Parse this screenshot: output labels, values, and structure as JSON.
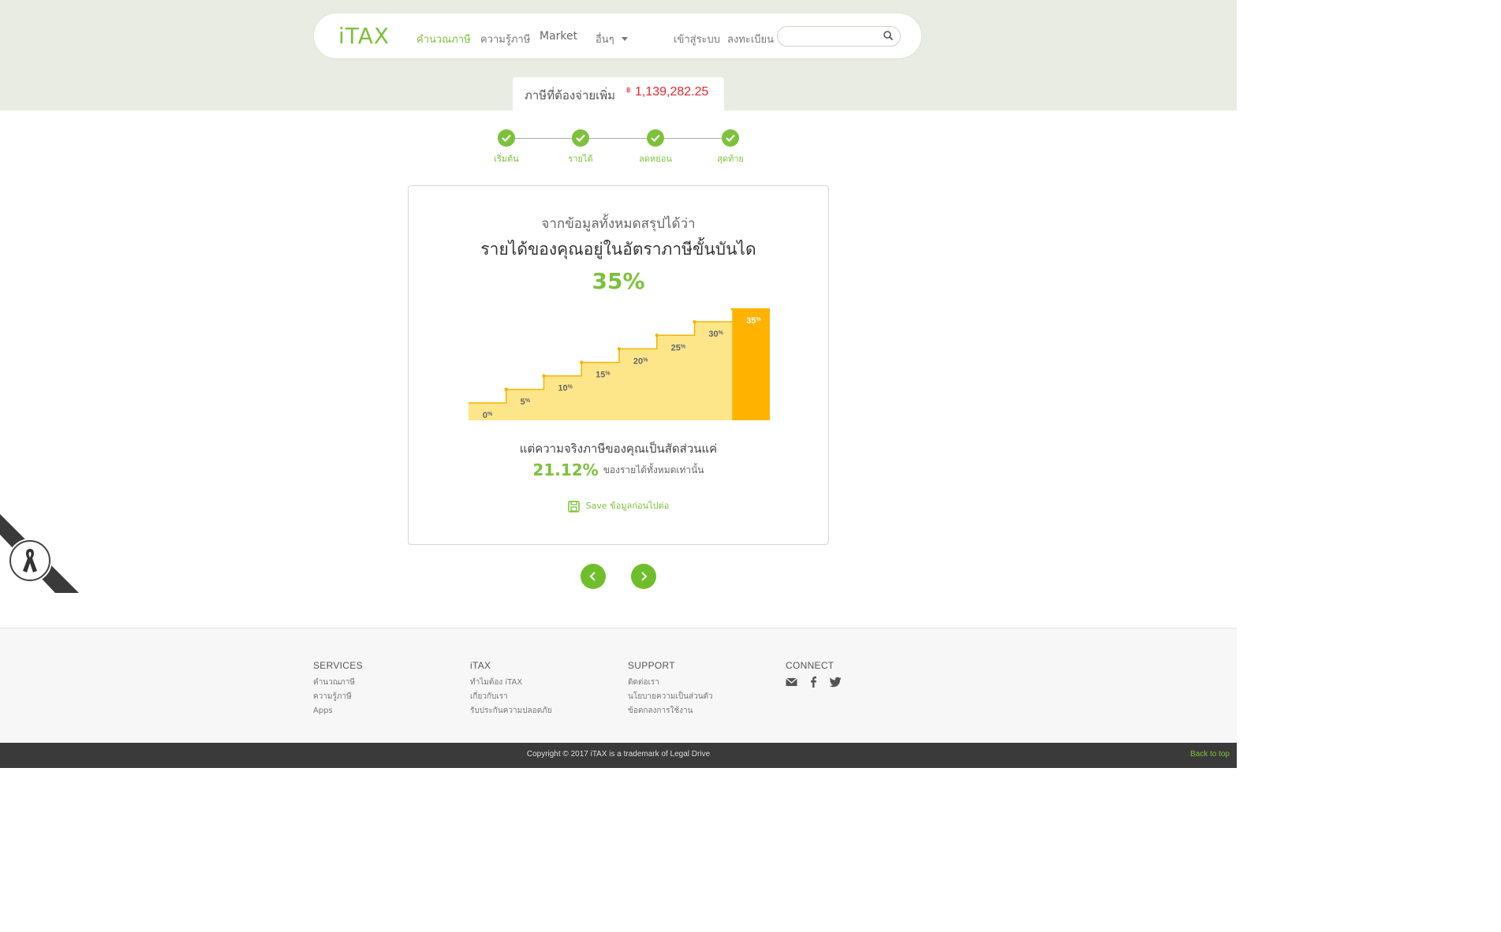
{
  "brand": {
    "logo": "iTAX",
    "accent": "#7cc13a",
    "alert": "#e8262e"
  },
  "nav": {
    "items": [
      "คำนวณภาษี",
      "ความรู้ภาษี",
      "Market",
      "อื่นๆ"
    ],
    "login": "เข้าสู่ระบบ",
    "register": "ลงทะเบียน",
    "search_placeholder": ""
  },
  "tax_due": {
    "label": "ภาษีที่ต้องจ่ายเพิ่ม",
    "currency": "฿",
    "amount": "1,139,282.25"
  },
  "steps": [
    "เริ่มต้น",
    "รายได้",
    "ลดหย่อน",
    "สุดท้าย"
  ],
  "summary": {
    "intro": "จากข้อมูลทั้งหมดสรุปได้ว่า",
    "headline": "รายได้ของคุณอยู่ในอัตราภาษีขั้นบันได",
    "bracket": "35%",
    "reality": "แต่ความจริงภาษีของคุณเป็นสัดส่วนแค่",
    "effective_rate": "21.12%",
    "effective_suffix": "ของรายได้ทั้งหมดเท่านั้น",
    "save_prefix": "Save",
    "save_text": "ข้อมูลก่อนไปต่อ"
  },
  "chart_data": {
    "type": "bar",
    "categories": [
      "0%",
      "5%",
      "10%",
      "15%",
      "20%",
      "25%",
      "30%",
      "35%"
    ],
    "values": [
      0,
      5,
      10,
      15,
      20,
      25,
      30,
      35
    ],
    "highlight_index": 7,
    "colors": {
      "base": "#fde68a",
      "line": "#f5b400",
      "highlight": "#ffb300"
    }
  },
  "footer": {
    "services": {
      "title": "SERVICES",
      "links": [
        "คำนวณภาษี",
        "ความรู้ภาษี",
        "Apps"
      ]
    },
    "itax": {
      "title": "iTAX",
      "links": [
        "ทำไมต้อง iTAX",
        "เกี่ยวกับเรา",
        "รับประกันความปลอดภัย"
      ]
    },
    "support": {
      "title": "SUPPORT",
      "links": [
        "ติดต่อเรา",
        "นโยบายความเป็นส่วนตัว",
        "ข้อตกลงการใช้งาน"
      ]
    },
    "connect": {
      "title": "CONNECT",
      "icons": [
        "email-icon",
        "facebook-icon",
        "twitter-icon"
      ]
    }
  },
  "copyright": "Copyright © 2017 iTAX is a trademark of Legal Drive",
  "back_to_top": "Back to top"
}
